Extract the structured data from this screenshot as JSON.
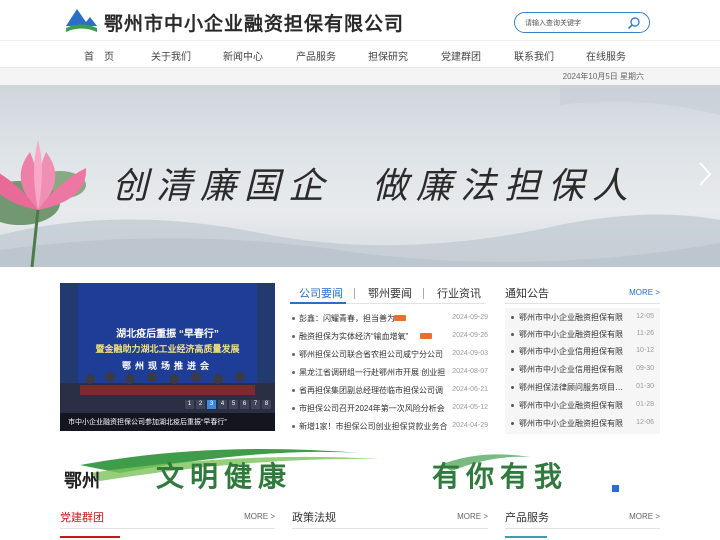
{
  "header": {
    "site_title": "鄂州市中小企业融资担保有限公司",
    "search_placeholder": "请输入查询关键字"
  },
  "nav": {
    "items": [
      "首　页",
      "关于我们",
      "新闻中心",
      "产品服务",
      "担保研究",
      "党建群团",
      "联系我们",
      "在线服务"
    ]
  },
  "dateline": "2024年10月5日 星期六",
  "banner": {
    "slogan_left": "创清廉国企",
    "slogan_right": "做廉法担保人"
  },
  "news_photo": {
    "caption": "市中小企业融资担保公司参加湖北疫后重振“早春行”",
    "pages": [
      "1",
      "2",
      "3",
      "4",
      "5",
      "6",
      "7",
      "8"
    ],
    "active_page": "3",
    "banner_line1": "湖北疫后重振 “早春行”",
    "banner_line2": "暨金融助力湖北工业经济高质量发展",
    "banner_line3": "鄂州现场推进会"
  },
  "news_tabs": [
    "公司要闻",
    "鄂州要闻",
    "行业资讯"
  ],
  "news": [
    {
      "title": "彭鑫：闪耀青春，担当善为",
      "date": "2024-09-29",
      "is_new": true
    },
    {
      "title": "融资担保为实体经济“输血增氧”",
      "date": "2024-09-26",
      "is_new": true
    },
    {
      "title": "鄂州担保公司联合省农担公司咸宁分公司",
      "date": "2024-09-03",
      "is_new": false
    },
    {
      "title": "黑龙江省调研组一行赴鄂州市开展 创业担",
      "date": "2024-08-07",
      "is_new": false
    },
    {
      "title": "省再担保集团副总经理莅临市担保公司调",
      "date": "2024-06-21",
      "is_new": false
    },
    {
      "title": "市担保公司召开2024年第一次风险分析会",
      "date": "2024-05-12",
      "is_new": false
    },
    {
      "title": "新增1家！市担保公司创业担保贷款业务合",
      "date": "2024-04-29",
      "is_new": false
    }
  ],
  "notices": {
    "title": "通知公告",
    "more": "MORE >",
    "items": [
      {
        "title": "鄂州市中小企业融资担保有限",
        "date": "12-05"
      },
      {
        "title": "鄂州市中小企业融资担保有限",
        "date": "11-26"
      },
      {
        "title": "鄂州市中小企业信用担保有限",
        "date": "10-12"
      },
      {
        "title": "鄂州市中小企业信用担保有限",
        "date": "09-30"
      },
      {
        "title": "鄂州担保法律顾问服务项目…",
        "date": "01-30"
      },
      {
        "title": "鄂州市中小企业融资担保有限",
        "date": "01-28"
      },
      {
        "title": "鄂州市中小企业融资担保有限",
        "date": "12-06"
      }
    ]
  },
  "ad_banner": {
    "mark": "鄂州",
    "text_left": "文明健康",
    "text_right": "有你有我"
  },
  "sections": [
    {
      "title": "党建群团",
      "more": "MORE >"
    },
    {
      "title": "政策法规",
      "more": "MORE >"
    },
    {
      "title": "产品服务",
      "more": "MORE >"
    }
  ],
  "colors": {
    "accent_blue": "#2a6fc5",
    "party_red": "#c8161d",
    "new_tag": "#e8702a",
    "ad_green": "#2f7a3c"
  }
}
